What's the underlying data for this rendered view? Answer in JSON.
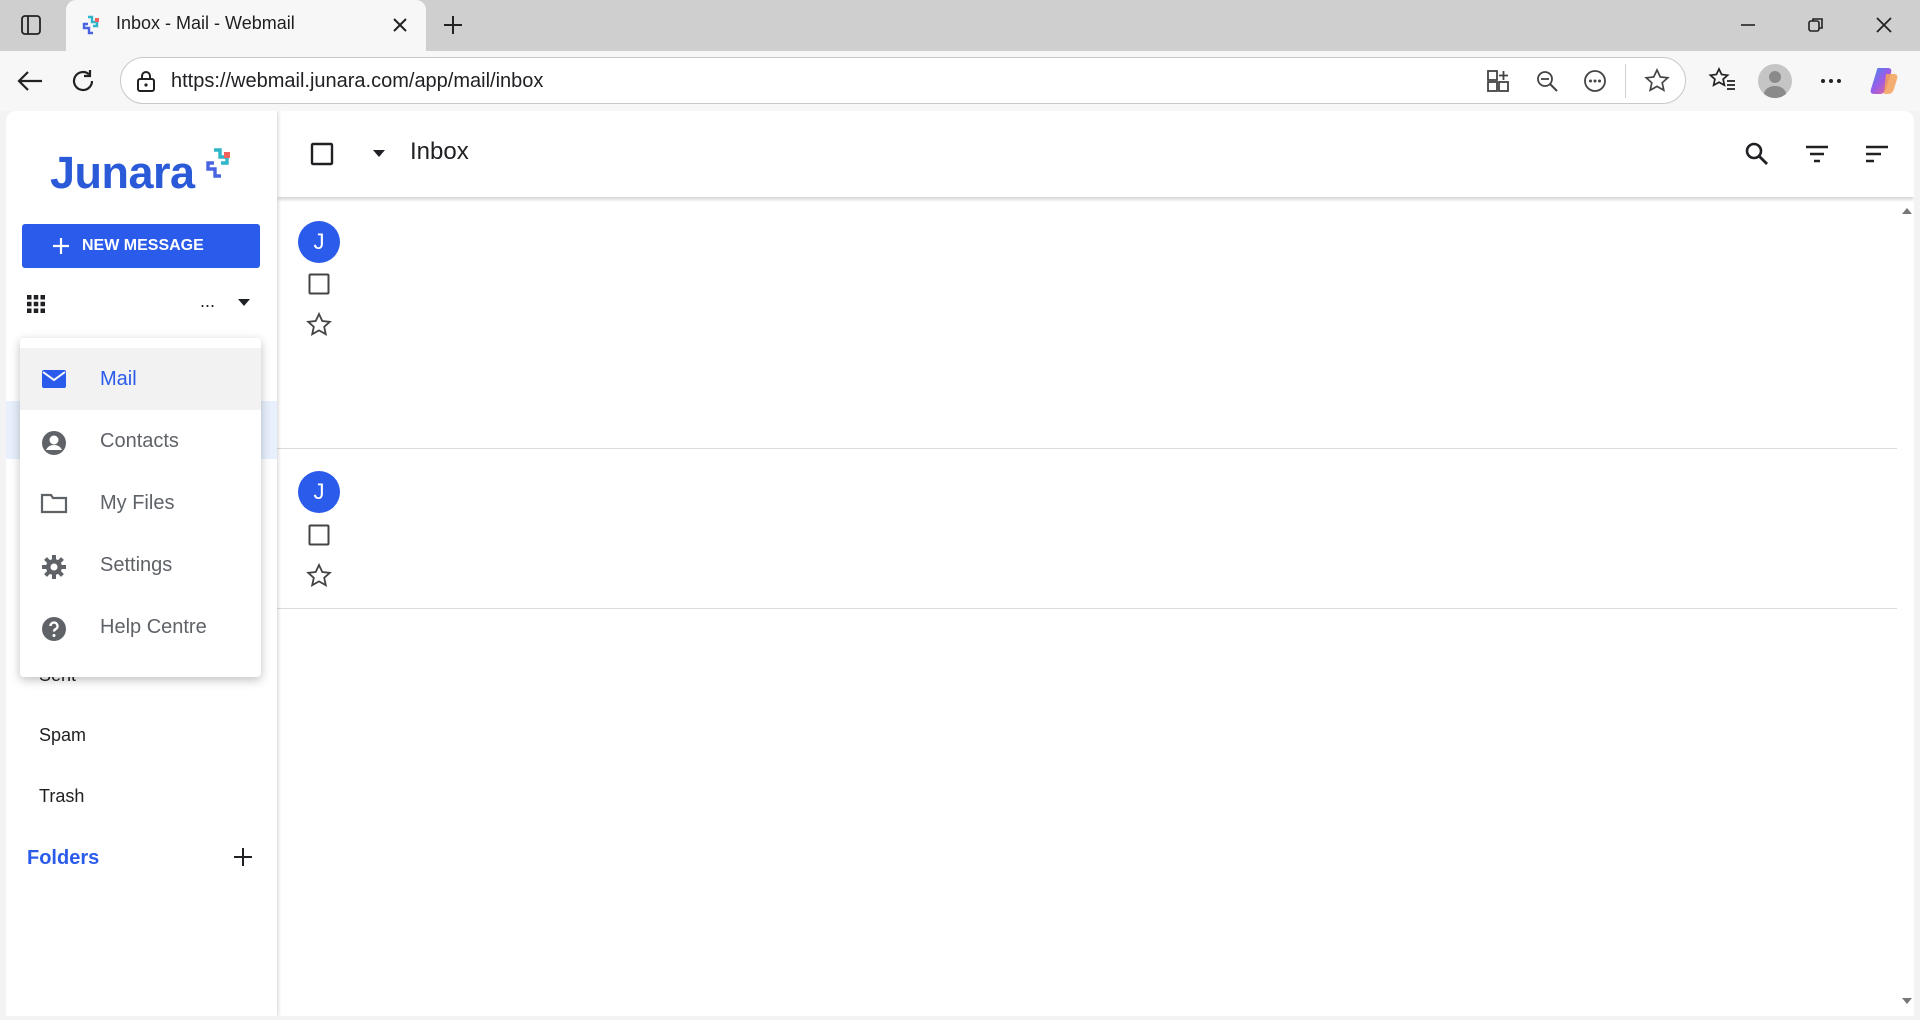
{
  "browser": {
    "tab_title": "Inbox - Mail - Webmail",
    "url": "https://webmail.junara.com/app/mail/inbox"
  },
  "sidebar": {
    "logo_text": "Junara",
    "new_message_label": "NEW MESSAGE",
    "account_label": "...",
    "nav_items": [
      {
        "label": "Sent"
      },
      {
        "label": "Spam"
      },
      {
        "label": "Trash"
      }
    ],
    "folders_label": "Folders"
  },
  "app_menu": {
    "items": [
      {
        "label": "Mail",
        "icon": "mail-icon",
        "active": true
      },
      {
        "label": "Contacts",
        "icon": "account-circle-icon",
        "active": false
      },
      {
        "label": "My Files",
        "icon": "folder-icon",
        "active": false
      },
      {
        "label": "Settings",
        "icon": "gear-icon",
        "active": false
      },
      {
        "label": "Help Centre",
        "icon": "help-icon",
        "active": false
      }
    ]
  },
  "main": {
    "title": "Inbox",
    "messages": [
      {
        "avatar_letter": "J"
      },
      {
        "avatar_letter": "J"
      }
    ]
  },
  "colors": {
    "accent": "#2a5bea",
    "logo": "#2a5ad8"
  }
}
